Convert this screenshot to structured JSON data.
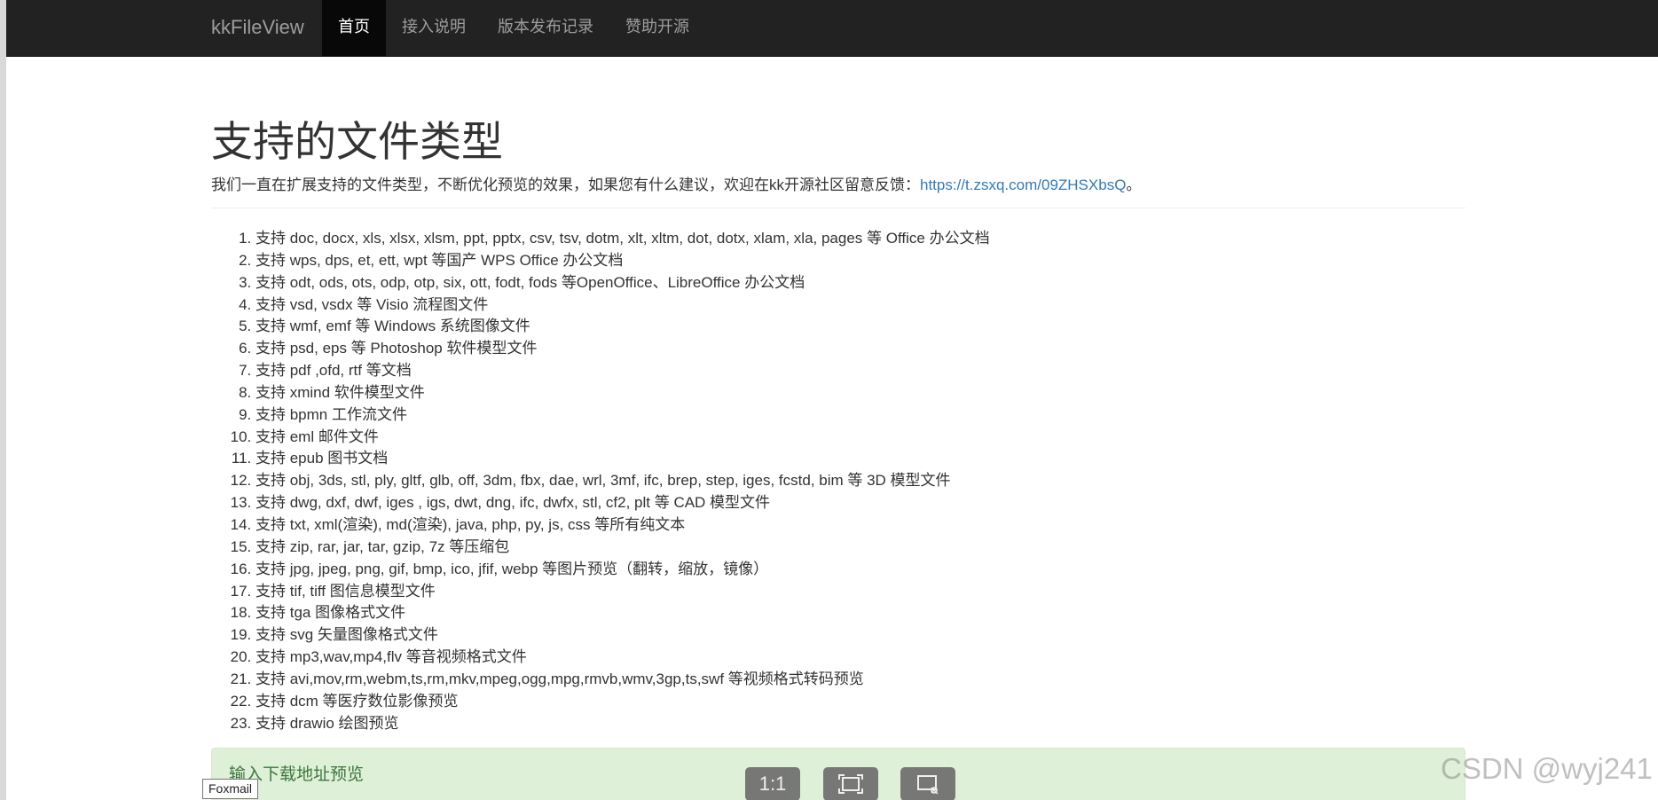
{
  "navbar": {
    "brand": "kkFileView",
    "items": [
      {
        "label": "首页",
        "active": true
      },
      {
        "label": "接入说明",
        "active": false
      },
      {
        "label": "版本发布记录",
        "active": false
      },
      {
        "label": "赞助开源",
        "active": false
      }
    ]
  },
  "main": {
    "title": "支持的文件类型",
    "lead_text": "我们一直在扩展支持的文件类型，不断优化预览的效果，如果您有什么建议，欢迎在kk开源社区留意反馈：",
    "lead_link": "https://t.zsxq.com/09ZHSXbsQ",
    "lead_end": "。",
    "types": [
      "支持 doc, docx, xls, xlsx, xlsm, ppt, pptx, csv, tsv, dotm, xlt, xltm, dot, dotx, xlam, xla, pages 等 Office 办公文档",
      "支持 wps, dps, et, ett, wpt 等国产 WPS Office 办公文档",
      "支持 odt, ods, ots, odp, otp, six, ott, fodt, fods 等OpenOffice、LibreOffice 办公文档",
      "支持 vsd, vsdx 等 Visio 流程图文件",
      "支持 wmf, emf 等 Windows 系统图像文件",
      "支持 psd, eps 等 Photoshop 软件模型文件",
      "支持 pdf ,ofd, rtf 等文档",
      "支持 xmind 软件模型文件",
      "支持 bpmn 工作流文件",
      "支持 eml 邮件文件",
      "支持 epub 图书文档",
      "支持 obj, 3ds, stl, ply, gltf, glb, off, 3dm, fbx, dae, wrl, 3mf, ifc, brep, step, iges, fcstd, bim 等 3D 模型文件",
      "支持 dwg, dxf, dwf, iges , igs, dwt, dng, ifc, dwfx, stl, cf2, plt 等 CAD 模型文件",
      "支持 txt, xml(渲染), md(渲染), java, php, py, js, css 等所有纯文本",
      "支持 zip, rar, jar, tar, gzip, 7z 等压缩包",
      "支持 jpg, jpeg, png, gif, bmp, ico, jfif, webp 等图片预览（翻转，缩放，镜像）",
      "支持 tif, tiff 图信息模型文件",
      "支持 tga 图像格式文件",
      "支持 svg 矢量图像格式文件",
      "支持 mp3,wav,mp4,flv 等音视频格式文件",
      "支持 avi,mov,rm,webm,ts,rm,mkv,mpeg,ogg,mpg,rmvb,wmv,3gp,ts,swf 等视频格式转码预览",
      "支持 dcm 等医疗数位影像预览",
      "支持 drawio 绘图预览"
    ],
    "alert_label": "输入下载地址预览"
  },
  "overlay": {
    "tooltip": "Foxmail",
    "zoom_label": "1:1",
    "watermark": "CSDN @wyj241"
  }
}
